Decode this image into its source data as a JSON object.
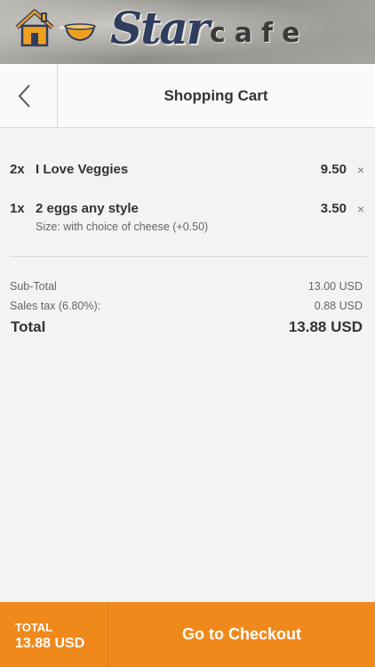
{
  "brand": {
    "word_star": "Star",
    "word_cafe": "cafe",
    "colors": {
      "accent": "#f0891c",
      "navy": "#2f3d5e"
    }
  },
  "header": {
    "title": "Shopping Cart",
    "back_icon": "chevron-left-icon"
  },
  "cart": {
    "items": [
      {
        "qty": "2x",
        "name": "I Love Veggies",
        "price": "9.50",
        "remove": "×"
      },
      {
        "qty": "1x",
        "name": "2 eggs any style",
        "price": "3.50",
        "option": "Size: with choice of cheese (+0.50)",
        "remove": "×"
      }
    ],
    "summary": {
      "subtotal_label": "Sub-Total",
      "subtotal_value": "13.00 USD",
      "tax_label": "Sales tax (6.80%):",
      "tax_value": "0.88 USD",
      "total_label": "Total",
      "total_value": "13.88 USD"
    }
  },
  "footer": {
    "total_label": "TOTAL",
    "total_value": "13.88 USD",
    "checkout_label": "Go to Checkout"
  }
}
